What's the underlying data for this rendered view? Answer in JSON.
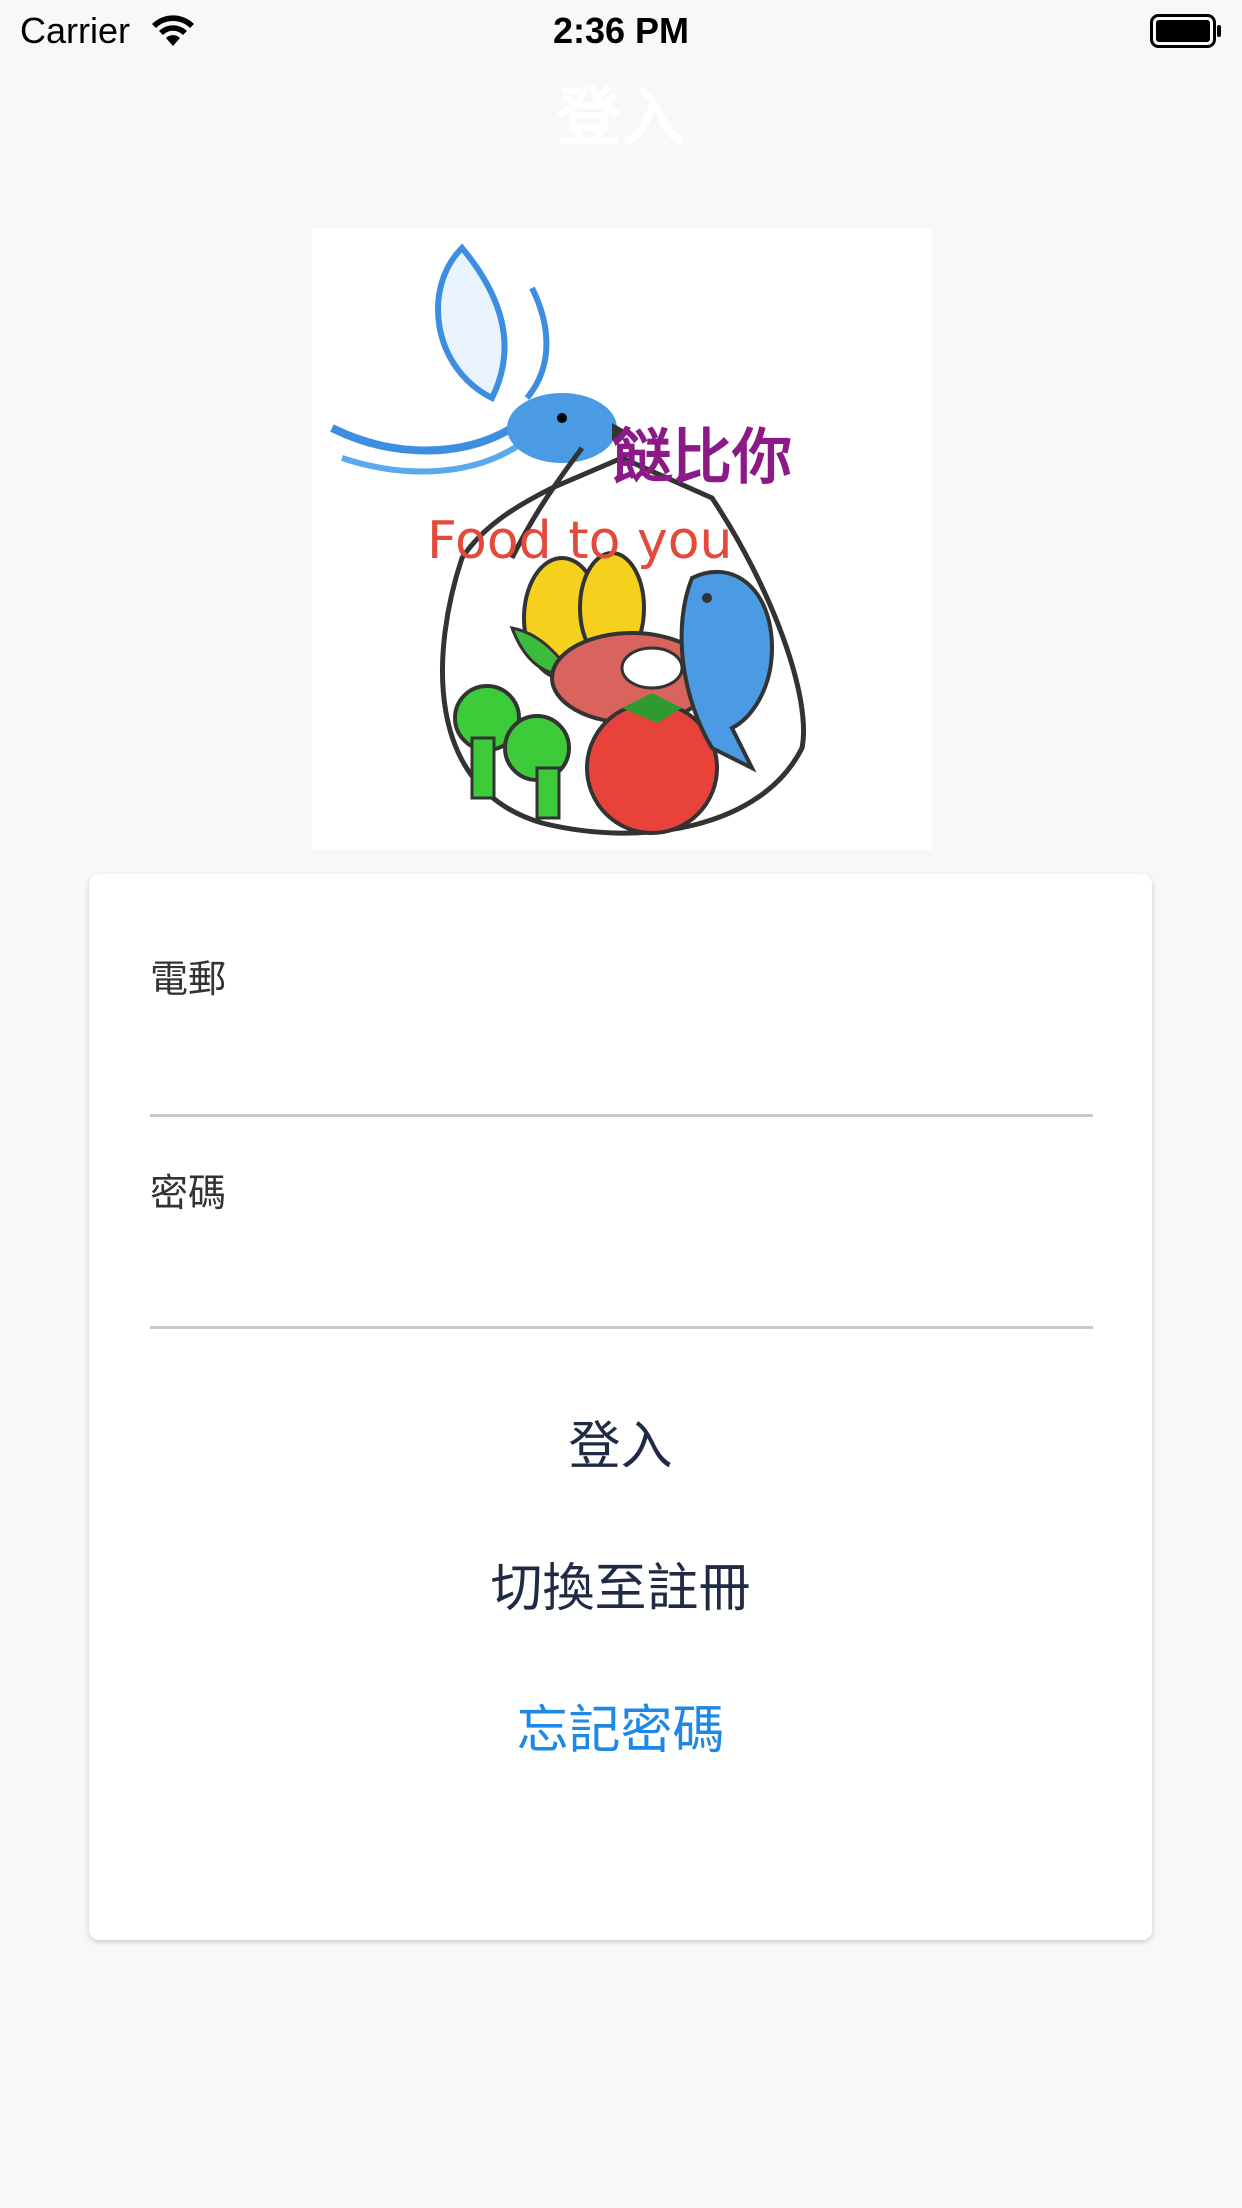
{
  "status_bar": {
    "carrier": "Carrier",
    "time": "2:36 PM"
  },
  "nav": {
    "title": "登入"
  },
  "logo": {
    "brand_chinese": "餸比你",
    "brand_english": "Food to you"
  },
  "form": {
    "email_label": "電郵",
    "email_value": "",
    "password_label": "密碼",
    "password_value": "",
    "login_button": "登入",
    "switch_button": "切換至註冊",
    "forgot_button": "忘記密碼"
  },
  "colors": {
    "background": "#f8f8f8",
    "card": "#ffffff",
    "button_text": "#1f2a44",
    "link": "#1e88e5",
    "underline": "#c8c8c8"
  }
}
